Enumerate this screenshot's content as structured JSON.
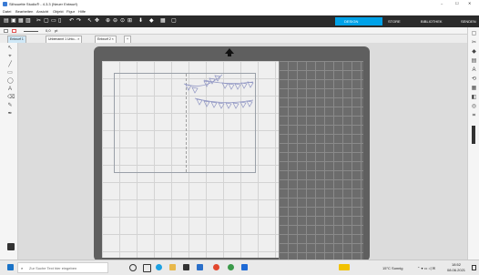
{
  "window": {
    "title": "Silhouette Studio® - 4.3.3 (Neuer Entwurf)",
    "controls": [
      "–",
      "☐",
      "✕"
    ]
  },
  "menu": [
    "Datei",
    "Bearbeiten",
    "Ansicht",
    "Objekt",
    "Figur",
    "Hilfe"
  ],
  "panels": [
    "DESIGN",
    "STORE",
    "BIBLIOTHEK",
    "SENDEN"
  ],
  "properties": {
    "zoom": "0,0",
    "unit": "pt"
  },
  "tabs": [
    "Entwurf 1",
    "Unbenannt 1 Unto... ×",
    "Entwurf 2 ×",
    "+"
  ],
  "taskbar": {
    "search_placeholder": "Zur Suche Text hier eingeben",
    "weather": "15°C  Sonnig",
    "time": "18:52",
    "date": "08.06.2021"
  },
  "colors": {
    "toolbar": "#2b2b2b",
    "accent": "#00a2e8",
    "mat": "#5f5f5f",
    "cut_lines": "#9ea3c0"
  },
  "icons": [
    "start-icon",
    "search-icon",
    "cortana-icon",
    "task-view-icon",
    "edge-icon",
    "explorer-icon",
    "store-icon",
    "mail-icon",
    "office-icon",
    "chrome-icon",
    "silhouette-icon"
  ]
}
